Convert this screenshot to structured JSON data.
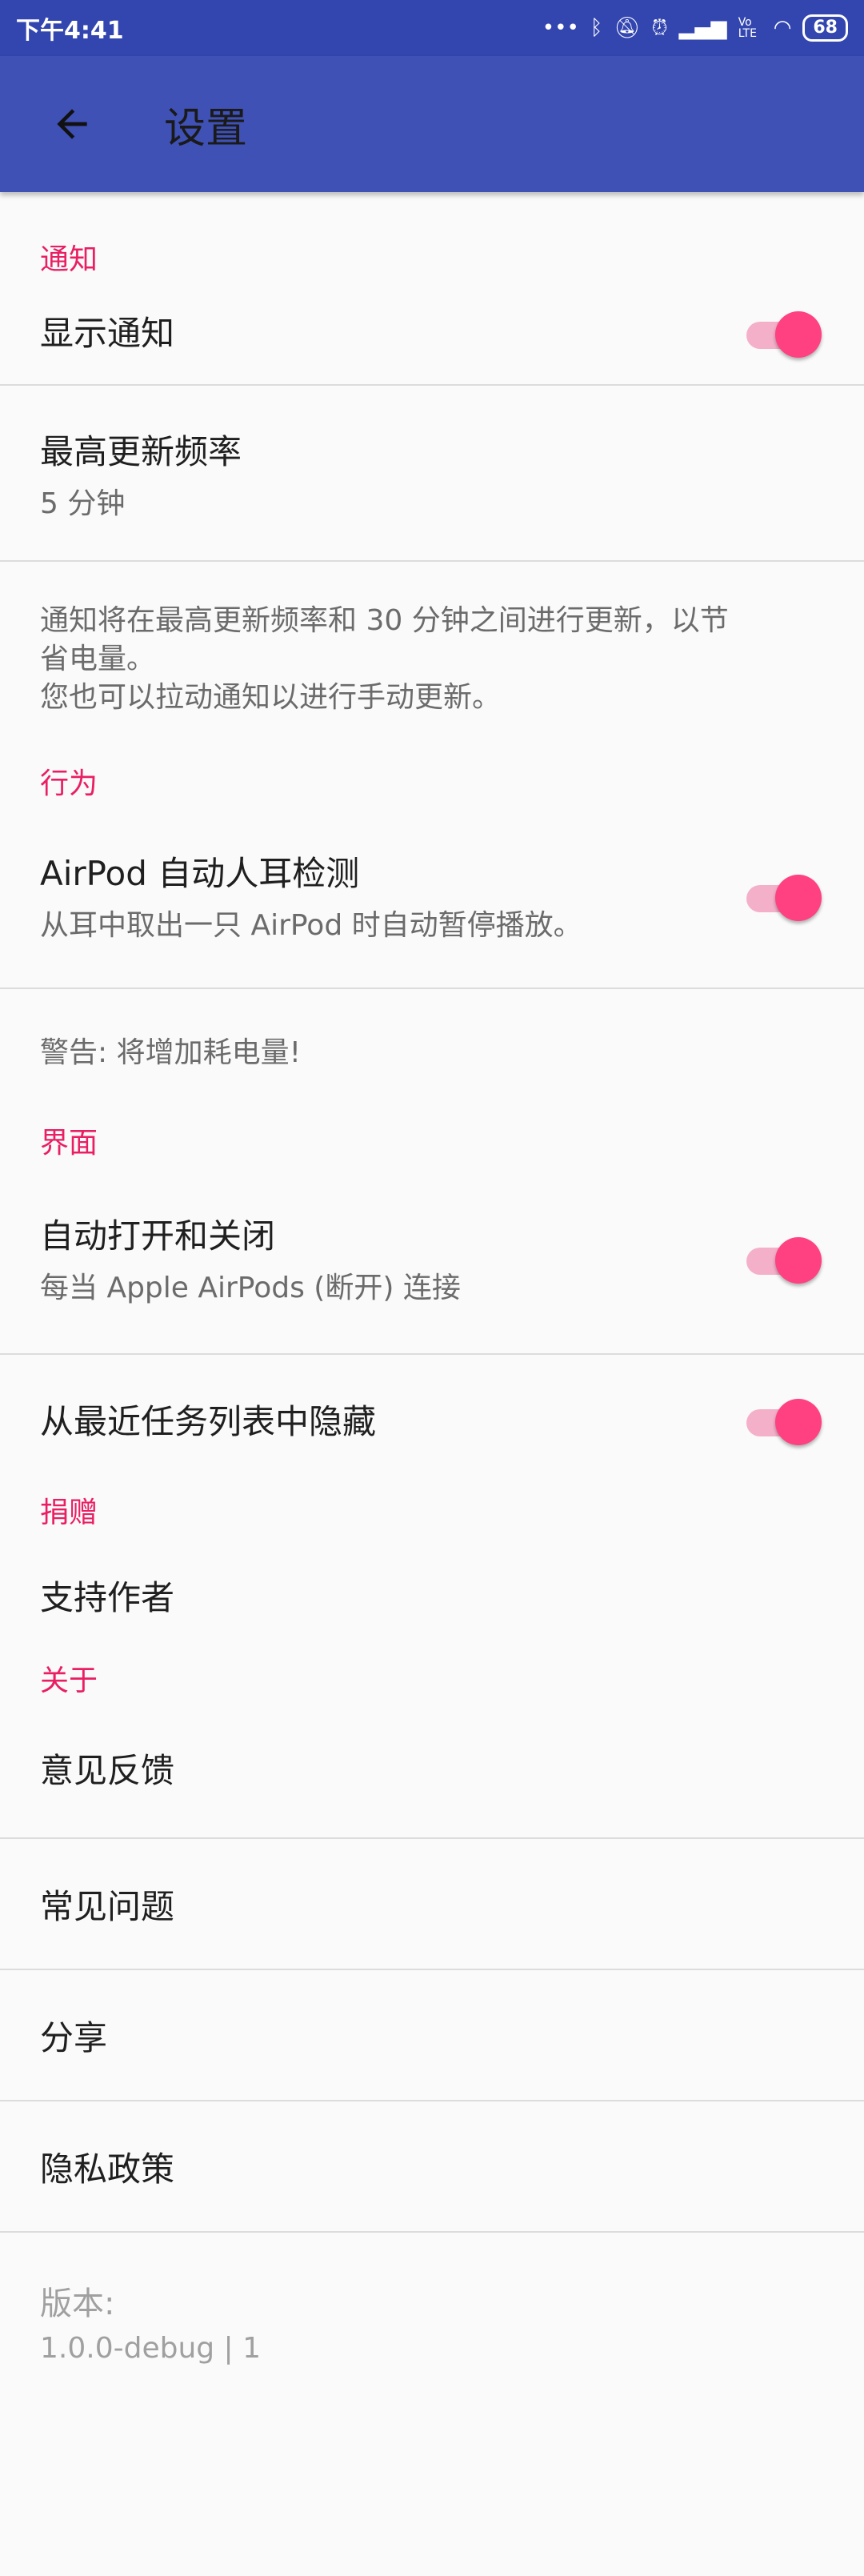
{
  "status_bar": {
    "time": "下午4:41",
    "battery": "68",
    "icons": [
      "more-dots-icon",
      "bluetooth-icon",
      "mute-icon",
      "alarm-icon",
      "signal-icon",
      "volte-icon",
      "wifi-icon",
      "battery-icon"
    ],
    "volte_label": "Vo LTE"
  },
  "appbar": {
    "title": "设置",
    "back_icon": "back-arrow-icon"
  },
  "sections": {
    "notify": {
      "header": "通知",
      "show_notifications": "显示通知",
      "max_rate_title": "最高更新频率",
      "max_rate_value": "5 分钟",
      "note_line1": "通知将在最高更新频率和 30 分钟之间进行更新，以节",
      "note_line2": "省电量。",
      "note_line3": "您也可以拉动通知以进行手动更新。"
    },
    "behavior": {
      "header": "行为",
      "ear_detect_title": "AirPod 自动人耳检测",
      "ear_detect_sub": "从耳中取出一只 AirPod 时自动暂停播放。",
      "warning": "警告: 将增加耗电量!"
    },
    "ui": {
      "header": "界面",
      "auto_open_title": "自动打开和关闭",
      "auto_open_sub": "每当 Apple AirPods (断开) 连接",
      "hide_recent": "从最近任务列表中隐藏"
    },
    "donate": {
      "header": "捐赠",
      "support": "支持作者"
    },
    "about": {
      "header": "关于",
      "feedback": "意见反馈",
      "faq": "常见问题",
      "share": "分享",
      "privacy": "隐私政策",
      "version_label": "版本:",
      "version_value": "1.0.0-debug | 1"
    }
  },
  "toggles": {
    "show_notifications": true,
    "ear_detect": true,
    "auto_open": true,
    "hide_recent": true
  },
  "colors": {
    "accent": "#e91e63",
    "primary": "#3f51b5",
    "thumb": "#ff4081"
  }
}
